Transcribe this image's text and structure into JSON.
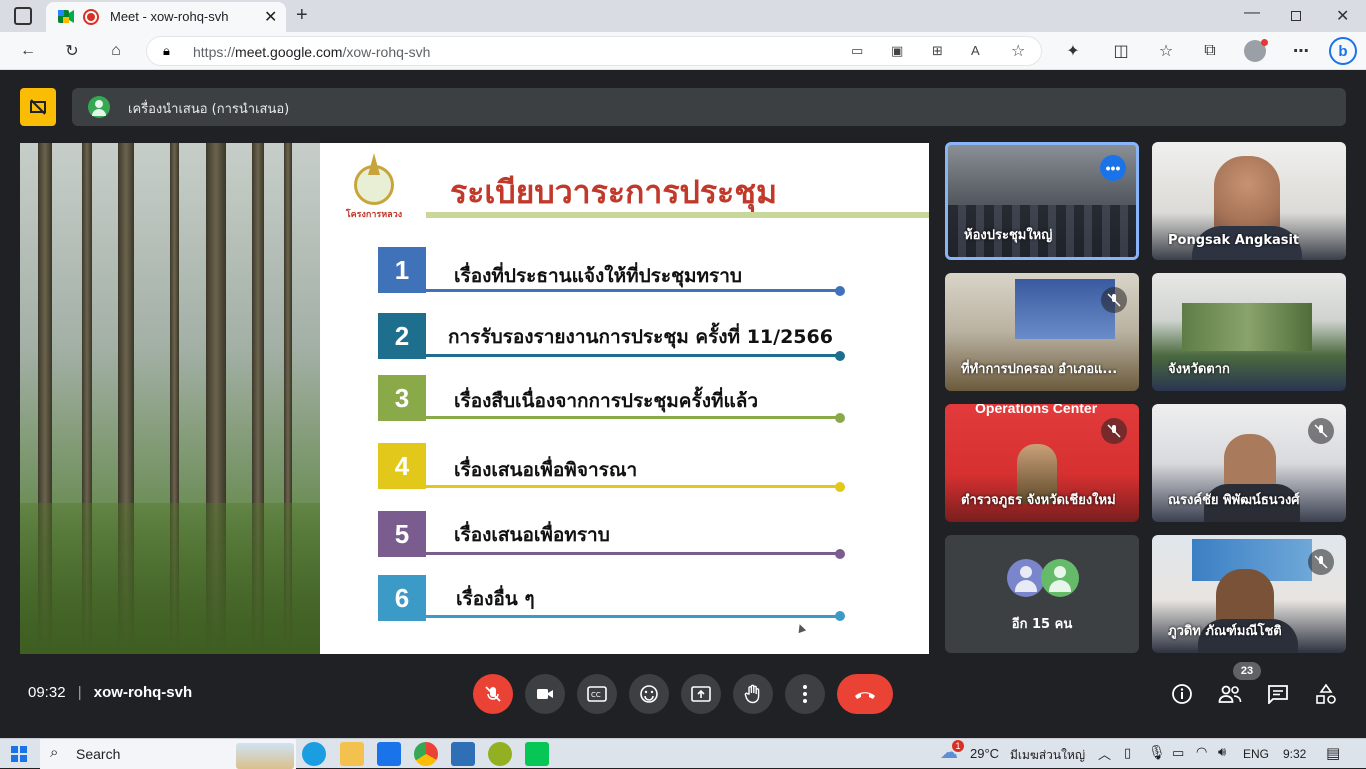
{
  "browser": {
    "tab_title": "Meet - xow-rohq-svh",
    "url_prefix": "https://",
    "url_host": "meet.google.com",
    "url_path": "/xow-rohq-svh"
  },
  "presentation_banner": {
    "label": "เครื่องนำเสนอ (การนำเสนอ)"
  },
  "slide": {
    "logo_caption": "โครงการหลวง",
    "title": "ระเบียบวาระการประชุม",
    "agenda": [
      {
        "num": "1",
        "text": "เรื่องที่ประธานแจ้งให้ที่ประชุมทราบ",
        "color": "#3f72b8"
      },
      {
        "num": "2",
        "text": "การรับรองรายงานการประชุม ครั้งที่ 11/2566",
        "color": "#1e6f8e"
      },
      {
        "num": "3",
        "text": "เรื่องสืบเนื่องจากการประชุมครั้งที่แล้ว",
        "color": "#8aaa4a"
      },
      {
        "num": "4",
        "text": "เรื่องเสนอเพื่อพิจารณา",
        "color": "#e2c81b"
      },
      {
        "num": "5",
        "text": "เรื่องเสนอเพื่อทราบ",
        "color": "#7a5d8e"
      },
      {
        "num": "6",
        "text": "เรื่องอื่น ๆ",
        "color": "#3c9bc6"
      }
    ]
  },
  "participants": [
    {
      "name": "ห้องประชุมใหญ่",
      "pinned": true,
      "muted": false
    },
    {
      "name": "Pongsak Angkasit",
      "muted": false
    },
    {
      "name": "ที่ทำการปกครอง อำเภอแ...",
      "muted": true
    },
    {
      "name": "จังหวัดตาก",
      "muted": false
    },
    {
      "name": "ตำรวจภูธร จังหวัดเชียงใหม่",
      "muted": true,
      "banner": "Operations Center"
    },
    {
      "name": "ณรงค์ชัย พิพัฒน์ธนวงศ์",
      "muted": true
    },
    {
      "name": "อีก 15 คน"
    },
    {
      "name": "ภูวดิท ภัณฑ์มณีโชติ",
      "muted": true
    }
  ],
  "bottom_bar": {
    "time": "09:32",
    "meeting_code": "xow-rohq-svh",
    "people_count": "23"
  },
  "taskbar": {
    "search": "Search",
    "weather_temp": "29°C",
    "weather_text": "มีเมฆส่วนใหญ่",
    "weather_badge": "1",
    "lang": "ENG",
    "clock": "9:32"
  },
  "colors": {
    "end_call": "#ea4335",
    "mic_off": "#ea4335",
    "pinned_border": "#8ab4f8",
    "banner_warn": "#fbbc04"
  }
}
